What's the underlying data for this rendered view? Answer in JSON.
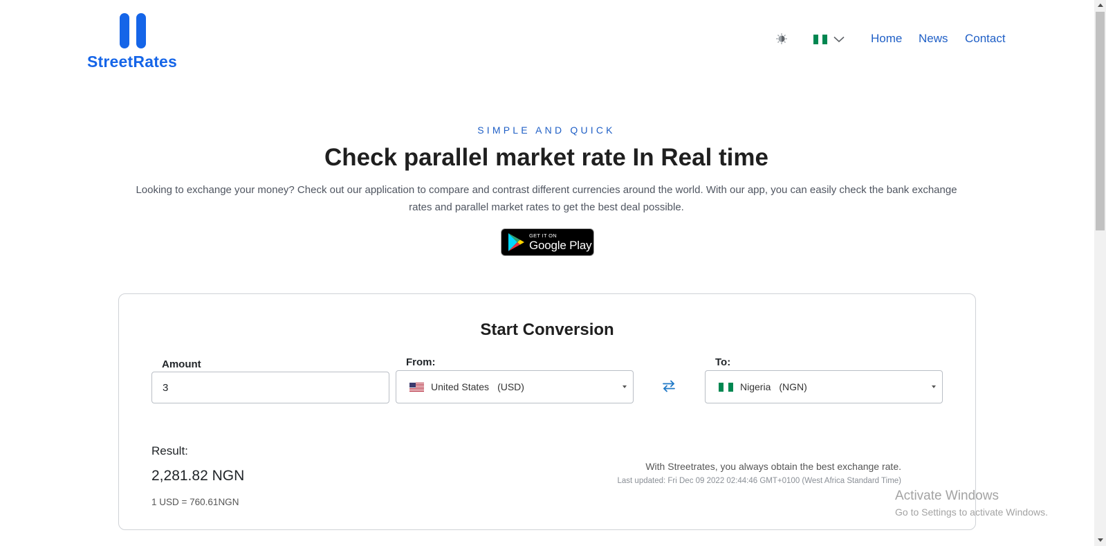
{
  "brand": {
    "name": "StreetRates",
    "color": "#1565e8"
  },
  "header": {
    "theme_toggle_icon": "brightness-icon",
    "language_flag": "nigeria-flag-icon",
    "nav": [
      {
        "label": "Home"
      },
      {
        "label": "News"
      },
      {
        "label": "Contact"
      }
    ]
  },
  "hero": {
    "eyebrow": "SIMPLE AND QUICK",
    "headline": "Check parallel market rate In Real time",
    "description": "Looking to exchange your money? Check out our application to compare and contrast different currencies around the world. With our app, you can easily check the bank exchange rates and parallel market rates to get the best deal possible.",
    "store_badge": {
      "small": "GET IT ON",
      "big": "Google Play"
    }
  },
  "converter": {
    "title": "Start Conversion",
    "amount": {
      "label": "Amount",
      "value": "3"
    },
    "from": {
      "label": "From:",
      "country": "United States",
      "code": "(USD)",
      "flag": "us-flag-icon"
    },
    "to": {
      "label": "To:",
      "country": "Nigeria",
      "code": "(NGN)",
      "flag": "nigeria-flag-icon"
    },
    "swap_icon": "swap-arrows-icon",
    "result": {
      "label": "Result:",
      "value": "2,281.82 NGN",
      "rate": "1 USD = 760.61NGN"
    },
    "tagline": "With Streetrates, you always obtain the best exchange rate.",
    "last_updated": "Last updated: Fri Dec 09 2022 02:44:46 GMT+0100 (West Africa Standard Time)"
  },
  "watermark": {
    "title": "Activate Windows",
    "subtitle": "Go to Settings to activate Windows."
  },
  "colors": {
    "accent": "#1f5fc6",
    "nigeria_green": "#008751"
  }
}
